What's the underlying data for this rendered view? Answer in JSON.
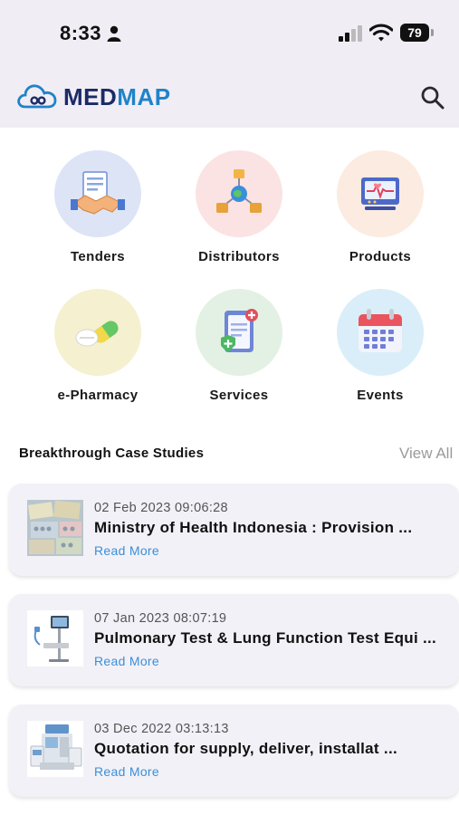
{
  "status_bar": {
    "time": "8:33",
    "battery": "79"
  },
  "header": {
    "brand_part1": "MED",
    "brand_part2": "MAP"
  },
  "categories": [
    {
      "label": "Tenders",
      "color": "#dde4f6"
    },
    {
      "label": "Distributors",
      "color": "#fbe3e3"
    },
    {
      "label": "Products",
      "color": "#fcebe0"
    },
    {
      "label": "e-Pharmacy",
      "color": "#f5f0cf"
    },
    {
      "label": "Services",
      "color": "#e2f1e4"
    },
    {
      "label": "Events",
      "color": "#d9eef8"
    }
  ],
  "case_studies": {
    "title": "Breakthrough Case Studies",
    "view_all": "View All",
    "items": [
      {
        "date": "02 Feb 2023 09:06:28",
        "title": "Ministry of Health Indonesia : Provision ...",
        "read_more": "Read More"
      },
      {
        "date": "07 Jan 2023 08:07:19",
        "title": "Pulmonary Test & Lung Function Test Equi ...",
        "read_more": "Read More"
      },
      {
        "date": "03 Dec 2022 03:13:13",
        "title": "Quotation for supply, deliver, installat ...",
        "read_more": "Read More"
      }
    ]
  }
}
